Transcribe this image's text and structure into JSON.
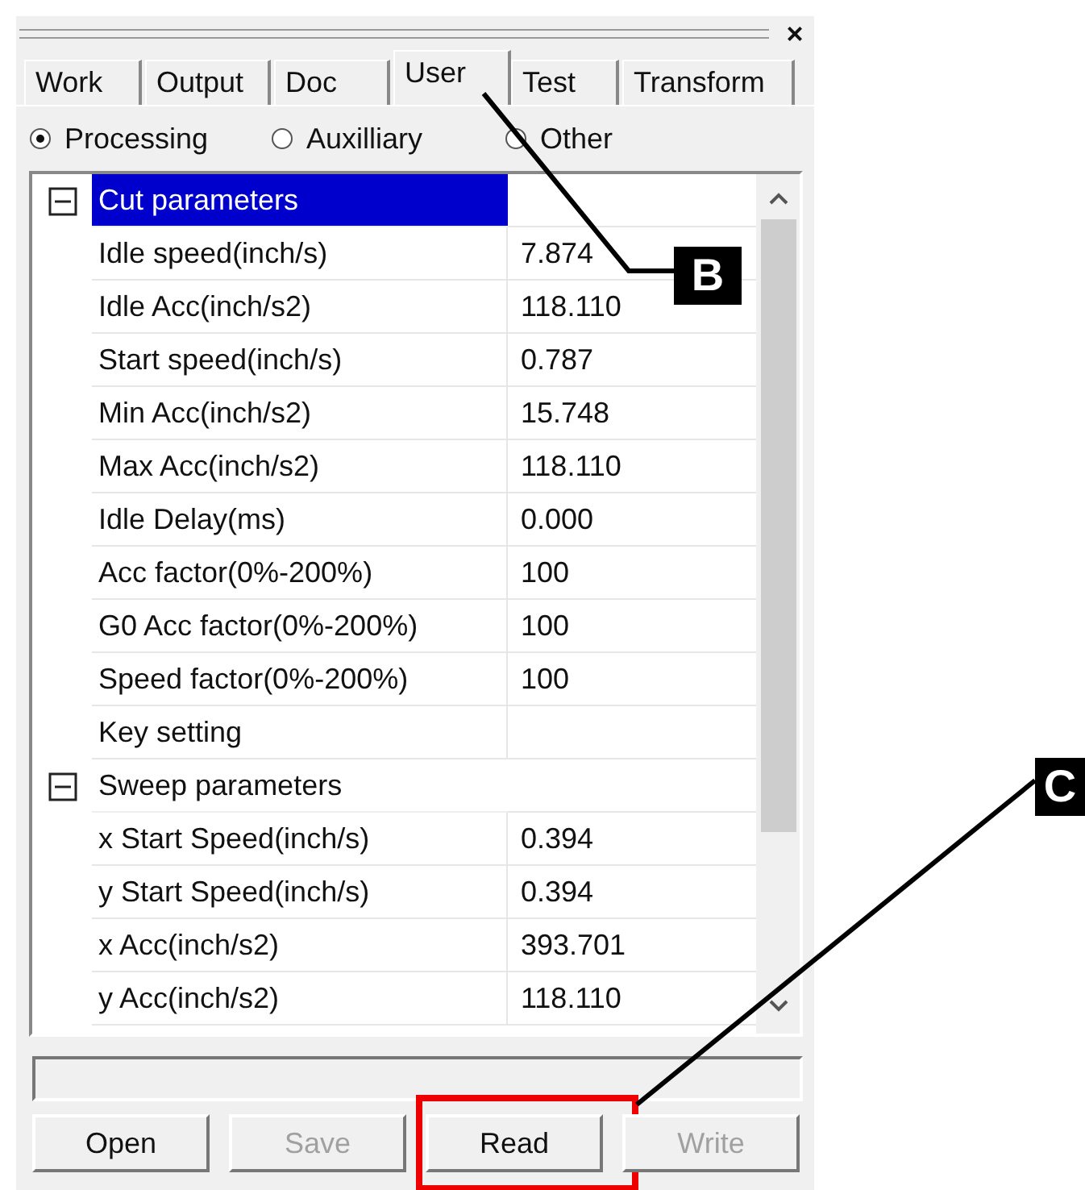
{
  "window": {
    "close_glyph": "×"
  },
  "tabs": [
    {
      "label": "Work",
      "selected": false
    },
    {
      "label": "Output",
      "selected": false
    },
    {
      "label": "Doc",
      "selected": false
    },
    {
      "label": "User",
      "selected": true
    },
    {
      "label": "Test",
      "selected": false
    },
    {
      "label": "Transform",
      "selected": false
    }
  ],
  "radios": [
    {
      "label": "Processing",
      "selected": true
    },
    {
      "label": "Auxilliary",
      "selected": false
    },
    {
      "label": "Other",
      "selected": false
    }
  ],
  "grid": {
    "groups": [
      {
        "name": "Cut parameters",
        "expanded": true,
        "selected": true,
        "children": [
          {
            "name": "Idle speed(inch/s)",
            "value": "7.874"
          },
          {
            "name": "Idle Acc(inch/s2)",
            "value": "118.110"
          },
          {
            "name": "Start speed(inch/s)",
            "value": "0.787"
          },
          {
            "name": "Min Acc(inch/s2)",
            "value": "15.748"
          },
          {
            "name": "Max Acc(inch/s2)",
            "value": "118.110"
          },
          {
            "name": "Idle Delay(ms)",
            "value": "0.000"
          },
          {
            "name": "Acc factor(0%-200%)",
            "value": "100"
          },
          {
            "name": "G0 Acc factor(0%-200%)",
            "value": "100"
          },
          {
            "name": "Speed factor(0%-200%)",
            "value": "100"
          },
          {
            "name": "Key setting"
          }
        ]
      },
      {
        "name": "Sweep parameters",
        "expanded": true,
        "selected": false,
        "children": [
          {
            "name": "x Start Speed(inch/s)",
            "value": "0.394"
          },
          {
            "name": "y Start Speed(inch/s)",
            "value": "0.394"
          },
          {
            "name": "x Acc(inch/s2)",
            "value": "393.701"
          },
          {
            "name": "y Acc(inch/s2)",
            "value": "118.110"
          }
        ]
      }
    ]
  },
  "buttons": [
    {
      "label": "Open",
      "disabled": false,
      "highlighted": false
    },
    {
      "label": "Save",
      "disabled": true,
      "highlighted": false
    },
    {
      "label": "Read",
      "disabled": false,
      "highlighted": true
    },
    {
      "label": "Write",
      "disabled": true,
      "highlighted": false
    }
  ],
  "annotations": [
    {
      "label": "B"
    },
    {
      "label": "C"
    }
  ]
}
